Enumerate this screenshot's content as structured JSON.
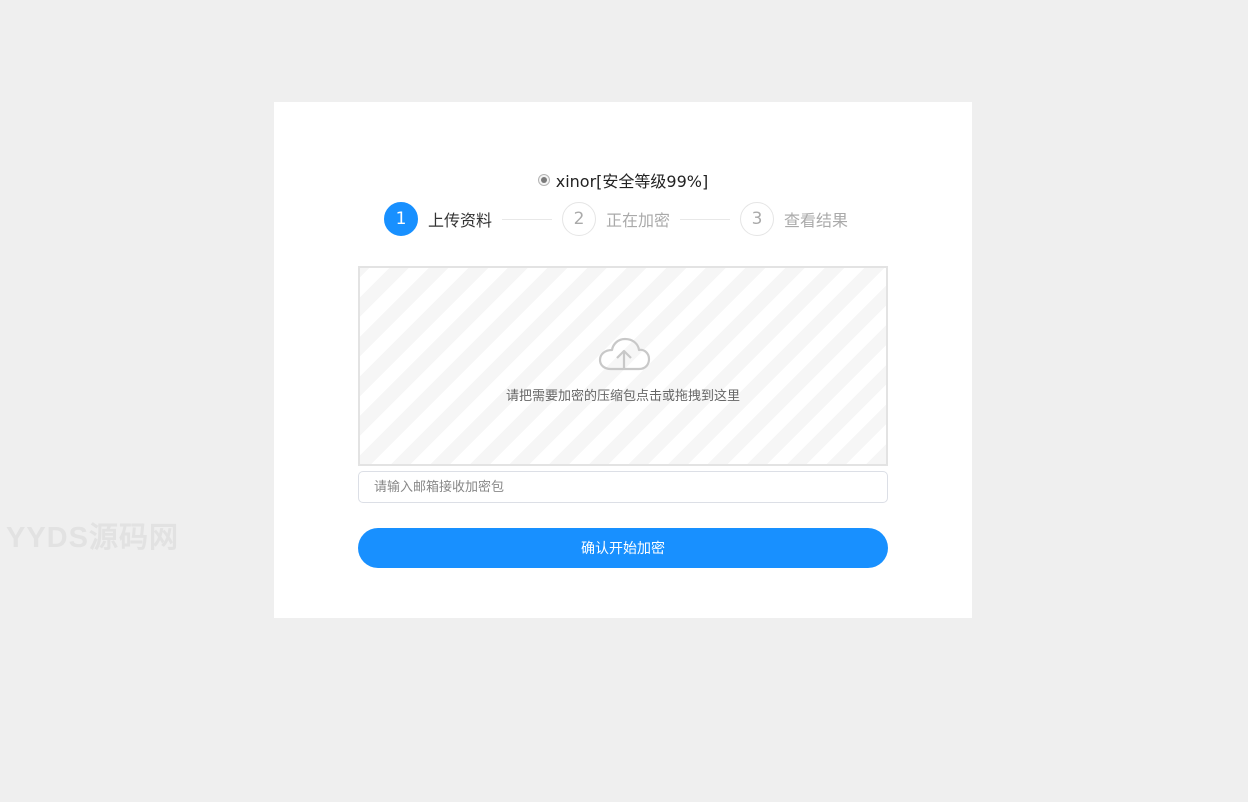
{
  "watermark": "YYDS源码网",
  "algorithm": {
    "option_label": "xinor[安全等级99%]",
    "selected": true
  },
  "steps": [
    {
      "number": "1",
      "label": "上传资料",
      "active": true
    },
    {
      "number": "2",
      "label": "正在加密",
      "active": false
    },
    {
      "number": "3",
      "label": "查看结果",
      "active": false
    }
  ],
  "dropzone": {
    "icon": "cloud-upload-icon",
    "text": "请把需要加密的压缩包点击或拖拽到这里"
  },
  "email": {
    "placeholder": "请输入邮箱接收加密包",
    "value": ""
  },
  "submit": {
    "label": "确认开始加密"
  },
  "colors": {
    "accent": "#1890ff",
    "background": "#efefef",
    "card": "#ffffff"
  }
}
